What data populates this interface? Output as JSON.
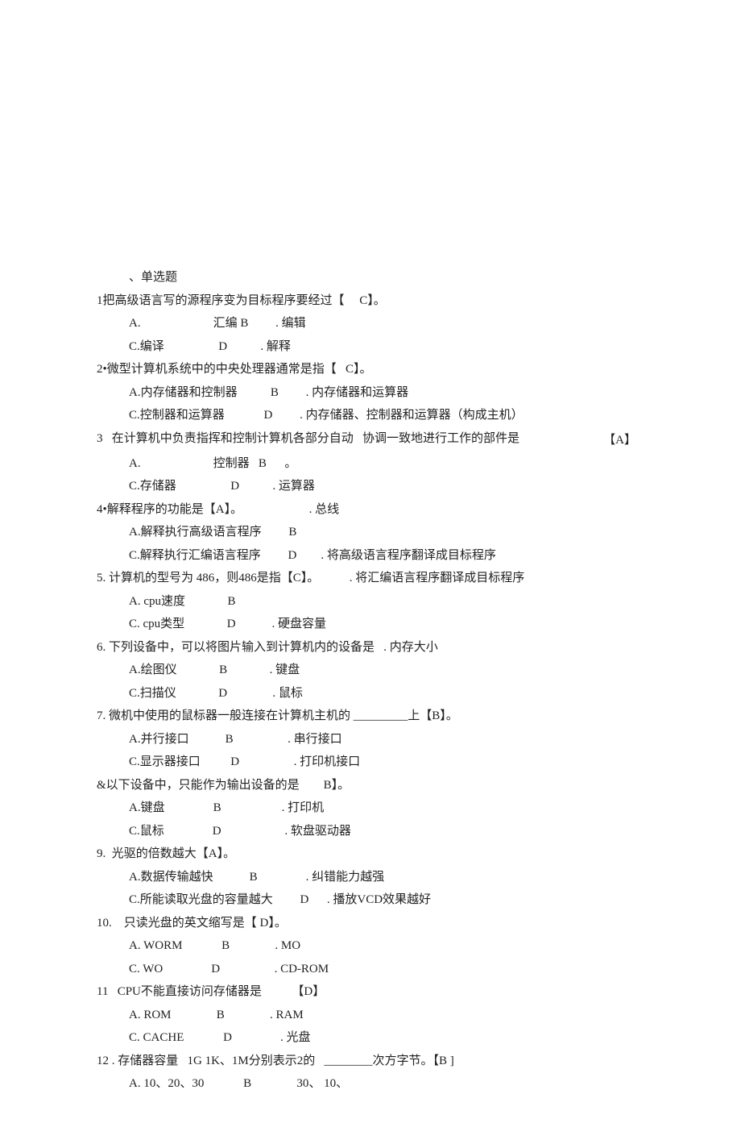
{
  "header": "、单选题",
  "q": [
    {
      "n": "1",
      "sep": "",
      "stem": "把高级语言写的源程序变为目标程序要经过【     C】。",
      "A": "",
      "Alabel": "汇编",
      "B": "",
      "Blabel": ". 编辑",
      "C": "编译",
      "Dlabel": ". 解释"
    },
    {
      "n": "2",
      "sep": "•",
      "stem": "微型计算机系统中的中央处理器通常是指【   C】。",
      "A": "内存储器和控制器",
      "Blabel": ". 内存储器和运算器",
      "C": "控制器和运算器",
      "Dlabel": ". 内存储器、控制器和运算器（构成主机）"
    },
    {
      "n": "3",
      "stem": "   在计算机中负责指挥和控制计算机各部分自动   协调一致地进行工作的部件是",
      "ans": "【A】",
      "A": "",
      "Alabel": "控制器",
      "B": "。",
      "C": "存储器",
      "Blabel2": ". 运算器",
      "Dlabel": ". 总线"
    },
    {
      "n": "4",
      "sep": "•",
      "stem": "解释程序的功能是【A】。",
      "A": "解释执行高级语言程序",
      "C": "解释执行汇编语言程序",
      "Blabel": ". 将高级语言程序翻译成目标程序",
      "Dlabel": ". 将汇编语言程序翻译成目标程序"
    },
    {
      "n": "5",
      "sep": ".",
      "stem": " 计算机的型号为 486，则486是指【C】。",
      "A": " cpu速度",
      "C": " cpu类型",
      "Blabel": ". 硬盘容量",
      "Dlabel": ". 内存大小"
    },
    {
      "n": "6",
      "sep": ".",
      "stem": " 下列设备中，可以将图片输入到计算机内的设备是",
      "A": "绘图仪",
      "Blabel": ". 键盘",
      "C": "扫描仪",
      "Dlabel": ". 鼠标"
    },
    {
      "n": "7",
      "sep": ".",
      "stem": " 微机中使用的鼠标器一般连接在计算机主机的 _________上【B】。",
      "A": "并行接口",
      "Blabel": ". 串行接口",
      "C": "显示器接口",
      "Dlabel": ". 打印机接口"
    },
    {
      "n": "&",
      "sep": "",
      "stem": "以下设备中，只能作为输出设备的是        B】。",
      "A": "键盘",
      "Blabel": ". 打印机",
      "C": "鼠标",
      "Dlabel": ". 软盘驱动器"
    },
    {
      "n": "9",
      "sep": ".",
      "stem": "  光驱的倍数越大【A】。",
      "A": "数据传输越快",
      "Blabel": ". 纠错能力越强",
      "C": "所能读取光盘的容量越大",
      "Dlabel": ". 播放VCD效果越好"
    },
    {
      "n": "10",
      "sep": ".",
      "stem": "    只读光盘的英文缩写是【 D】。",
      "A": " WORM",
      "Blabel": ". MO",
      "C": " WO",
      "Dlabel": ". CD-ROM"
    },
    {
      "n": "11",
      "sep": "",
      "stem": "   CPU不能直接访问存储器是          【D】",
      "A": " ROM",
      "Blabel": ". RAM",
      "C": " CACHE",
      "Dlabel": ". 光盘"
    },
    {
      "n": "12",
      "sep": " .",
      "stem": " 存储器容量   1G 1K、1M分别表示2的   ________次方字节。【B ]",
      "A": " 10、20、30",
      "Blabel": "       30、 10、"
    }
  ]
}
